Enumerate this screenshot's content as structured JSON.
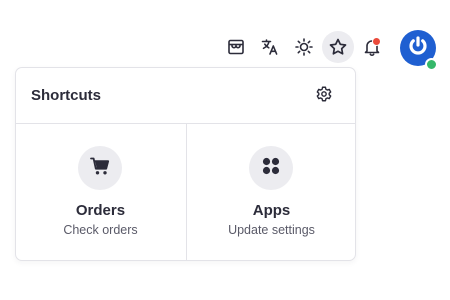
{
  "topbar": {
    "icons": [
      "storefront-icon",
      "translate-icon",
      "sun-icon",
      "star-icon",
      "bell-icon"
    ],
    "active_icon": "star-icon",
    "notification_dot_color": "#ea4a3a"
  },
  "user": {
    "avatar_icon": "power-icon",
    "avatar_color": "#1f5fd1",
    "status_color": "#35b86a"
  },
  "shortcuts": {
    "title": "Shortcuts",
    "settings_icon": "gear-icon",
    "items": [
      {
        "label": "Orders",
        "subtitle": "Check orders",
        "icon": "cart-icon"
      },
      {
        "label": "Apps",
        "subtitle": "Update settings",
        "icon": "apps-icon"
      }
    ]
  }
}
